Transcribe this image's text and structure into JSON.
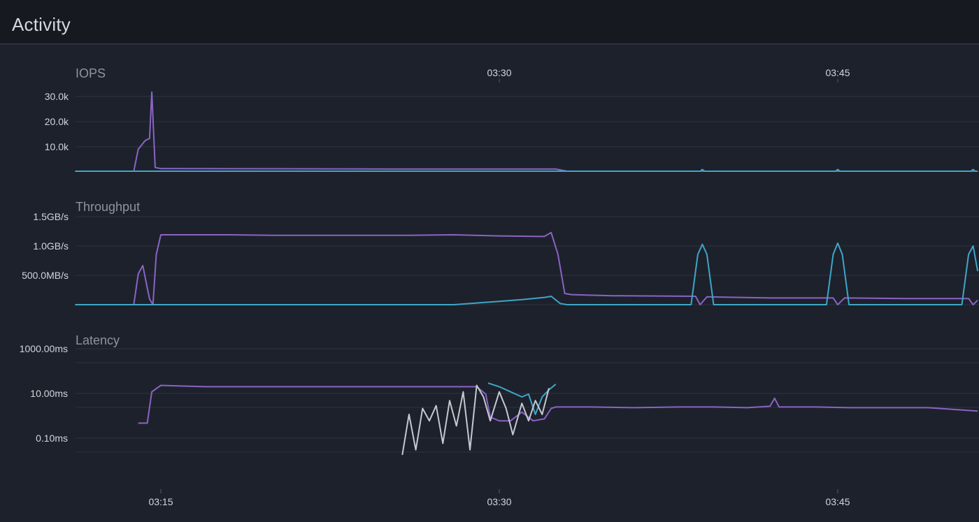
{
  "header": {
    "title": "Activity"
  },
  "colors": {
    "read": "#8b63c4",
    "write": "#3ea6c7",
    "other": "#c4c9cf"
  },
  "chart_data": [
    {
      "type": "line",
      "title": "IOPS",
      "x_ticks": [
        "03:30",
        "03:45"
      ],
      "x_tick_minutes": [
        30,
        45
      ],
      "y_ticks": [
        "30.0k",
        "20.0k",
        "10.0k"
      ],
      "y_tick_values": [
        30000,
        20000,
        10000
      ],
      "ylim": [
        0,
        33000
      ],
      "xlim": [
        11.2,
        51.2
      ],
      "series": [
        {
          "color_key": "read",
          "points": [
            [
              11.2,
              0
            ],
            [
              13.8,
              0
            ],
            [
              14.0,
              9000
            ],
            [
              14.3,
              12500
            ],
            [
              14.5,
              13500
            ],
            [
              14.6,
              32500
            ],
            [
              14.75,
              1500
            ],
            [
              15,
              1100
            ],
            [
              20,
              1000
            ],
            [
              25,
              900
            ],
            [
              30,
              900
            ],
            [
              32.5,
              900
            ],
            [
              33,
              0
            ],
            [
              51.2,
              0
            ]
          ]
        },
        {
          "color_key": "write",
          "points": [
            [
              11.2,
              0
            ],
            [
              38.9,
              0
            ],
            [
              39.0,
              700
            ],
            [
              39.1,
              0
            ],
            [
              44.9,
              0
            ],
            [
              45.0,
              700
            ],
            [
              45.1,
              0
            ],
            [
              50.9,
              0
            ],
            [
              51.0,
              700
            ],
            [
              51.1,
              0
            ],
            [
              51.2,
              0
            ]
          ]
        }
      ]
    },
    {
      "type": "line",
      "title": "Throughput",
      "y_ticks": [
        "1.5GB/s",
        "1.0GB/s",
        "500.0MB/s"
      ],
      "y_tick_values": [
        1500,
        1000,
        500
      ],
      "ylim": [
        0,
        1700
      ],
      "xlim": [
        11.2,
        51.2
      ],
      "series": [
        {
          "color_key": "read",
          "points": [
            [
              11.2,
              0
            ],
            [
              13.8,
              0
            ],
            [
              14.0,
              550
            ],
            [
              14.2,
              700
            ],
            [
              14.4,
              300
            ],
            [
              14.5,
              100
            ],
            [
              14.65,
              0
            ],
            [
              14.8,
              900
            ],
            [
              15.0,
              1250
            ],
            [
              16,
              1250
            ],
            [
              18,
              1250
            ],
            [
              20,
              1240
            ],
            [
              22,
              1240
            ],
            [
              24,
              1240
            ],
            [
              26,
              1240
            ],
            [
              28,
              1250
            ],
            [
              30,
              1230
            ],
            [
              32,
              1220
            ],
            [
              32.3,
              1290
            ],
            [
              32.6,
              900
            ],
            [
              32.9,
              200
            ],
            [
              33.2,
              180
            ],
            [
              35,
              160
            ],
            [
              38.7,
              150
            ],
            [
              38.9,
              0
            ],
            [
              39.2,
              140
            ],
            [
              42,
              120
            ],
            [
              44.8,
              120
            ],
            [
              45.0,
              0
            ],
            [
              45.3,
              120
            ],
            [
              48,
              110
            ],
            [
              50.8,
              110
            ],
            [
              51.0,
              0
            ],
            [
              51.2,
              80
            ]
          ]
        },
        {
          "color_key": "write",
          "points": [
            [
              11.2,
              0
            ],
            [
              28,
              0
            ],
            [
              29,
              30
            ],
            [
              30,
              60
            ],
            [
              31,
              90
            ],
            [
              32,
              130
            ],
            [
              32.3,
              150
            ],
            [
              32.7,
              20
            ],
            [
              33,
              0
            ],
            [
              38.5,
              0
            ],
            [
              38.8,
              900
            ],
            [
              39.0,
              1080
            ],
            [
              39.2,
              900
            ],
            [
              39.5,
              0
            ],
            [
              44.5,
              0
            ],
            [
              44.8,
              900
            ],
            [
              45.0,
              1100
            ],
            [
              45.2,
              900
            ],
            [
              45.5,
              0
            ],
            [
              50.5,
              0
            ],
            [
              50.8,
              900
            ],
            [
              51.0,
              1050
            ],
            [
              51.2,
              600
            ]
          ]
        }
      ]
    },
    {
      "type": "line",
      "title": "Latency",
      "log_scale": true,
      "x_ticks": [
        "03:15",
        "03:30",
        "03:45"
      ],
      "x_tick_minutes": [
        15,
        30,
        45
      ],
      "y_ticks": [
        "1000.00ms",
        "10.00ms",
        "0.10ms"
      ],
      "y_tick_values": [
        1000,
        10,
        0.1
      ],
      "ylim": [
        0.01,
        2000
      ],
      "xlim": [
        11.2,
        51.2
      ],
      "series": [
        {
          "color_key": "read",
          "points": [
            [
              14.0,
              2.5
            ],
            [
              14.4,
              2.5
            ],
            [
              14.6,
              30
            ],
            [
              15,
              50
            ],
            [
              17,
              45
            ],
            [
              19,
              45
            ],
            [
              21,
              45
            ],
            [
              23,
              45
            ],
            [
              25,
              45
            ],
            [
              27,
              45
            ],
            [
              29,
              45
            ],
            [
              29.4,
              25
            ],
            [
              29.6,
              4
            ],
            [
              30,
              3
            ],
            [
              30.5,
              3
            ],
            [
              31,
              6
            ],
            [
              31.5,
              3
            ],
            [
              32,
              3.5
            ],
            [
              32.3,
              8
            ],
            [
              32.5,
              9
            ],
            [
              34,
              9
            ],
            [
              36,
              8.5
            ],
            [
              38,
              9
            ],
            [
              39.5,
              9
            ],
            [
              41,
              8.5
            ],
            [
              42,
              9.5
            ],
            [
              42.2,
              18
            ],
            [
              42.4,
              9
            ],
            [
              44,
              9
            ],
            [
              45.5,
              8.5
            ],
            [
              47,
              8.5
            ],
            [
              49,
              8.5
            ],
            [
              51.2,
              6.5
            ]
          ]
        },
        {
          "color_key": "write",
          "points": [
            [
              29.5,
              60
            ],
            [
              30,
              45
            ],
            [
              30.5,
              30
            ],
            [
              31,
              20
            ],
            [
              31.3,
              25
            ],
            [
              31.6,
              5
            ],
            [
              31.9,
              20
            ],
            [
              32.2,
              35
            ],
            [
              32.5,
              55
            ]
          ]
        },
        {
          "color_key": "other",
          "points": [
            [
              25.7,
              0.2
            ],
            [
              26.0,
              5
            ],
            [
              26.3,
              0.3
            ],
            [
              26.6,
              8
            ],
            [
              26.9,
              3
            ],
            [
              27.2,
              10
            ],
            [
              27.5,
              0.5
            ],
            [
              27.8,
              15
            ],
            [
              28.1,
              2
            ],
            [
              28.4,
              30
            ],
            [
              28.7,
              0.3
            ],
            [
              29,
              50
            ],
            [
              29.3,
              20
            ],
            [
              29.6,
              3
            ],
            [
              30,
              30
            ],
            [
              30.3,
              8
            ],
            [
              30.6,
              1
            ],
            [
              31,
              12
            ],
            [
              31.3,
              3
            ],
            [
              31.6,
              15
            ],
            [
              31.9,
              5
            ],
            [
              32.2,
              40
            ]
          ]
        }
      ]
    }
  ]
}
